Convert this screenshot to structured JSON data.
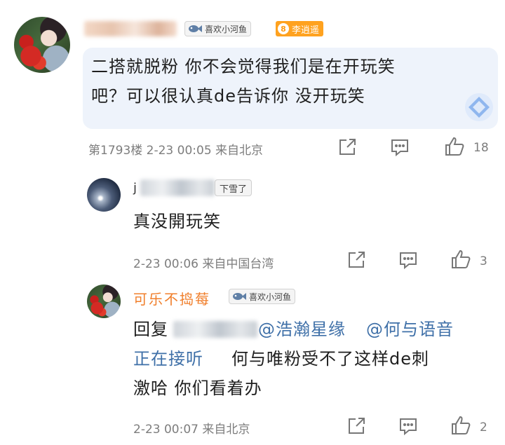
{
  "comments": [
    {
      "fan_badge": "喜欢小河鱼",
      "vip_level": "8",
      "vip_name": "李逍遥",
      "text_line1": "二搭就脱粉 你不会觉得我们是在开玩笑",
      "text_line2": "吧？可以很认真de告诉你 没开玩笑",
      "meta": "第1793楼 2-23 00:05 来自北京",
      "likes": "18"
    },
    {
      "name_prefix": "j",
      "badge": "下雪了",
      "text": "真没開玩笑",
      "meta": "2-23 00:06 来自中国台湾",
      "likes": "3"
    },
    {
      "name": "可乐不捣莓",
      "fan_badge": "喜欢小河鱼",
      "reply_prefix": "回复",
      "mention1": "@浩瀚星缘",
      "mention2": "@何与语音",
      "mention2_cont": "正在接听",
      "text_line2_rest": "何与唯粉受不了这样de刺",
      "text_line3": "激哈 你们看着办",
      "meta": "2-23 00:07 来自北京",
      "likes": "2"
    }
  ],
  "colors": {
    "link": "#3f70a8",
    "username_orange": "#f07e2a",
    "vip_badge": "#ffa21f",
    "meta_gray": "#7d7d7d"
  },
  "icons": [
    "share-icon",
    "comment-icon",
    "like-icon",
    "fish-icon",
    "diamond-icon"
  ]
}
